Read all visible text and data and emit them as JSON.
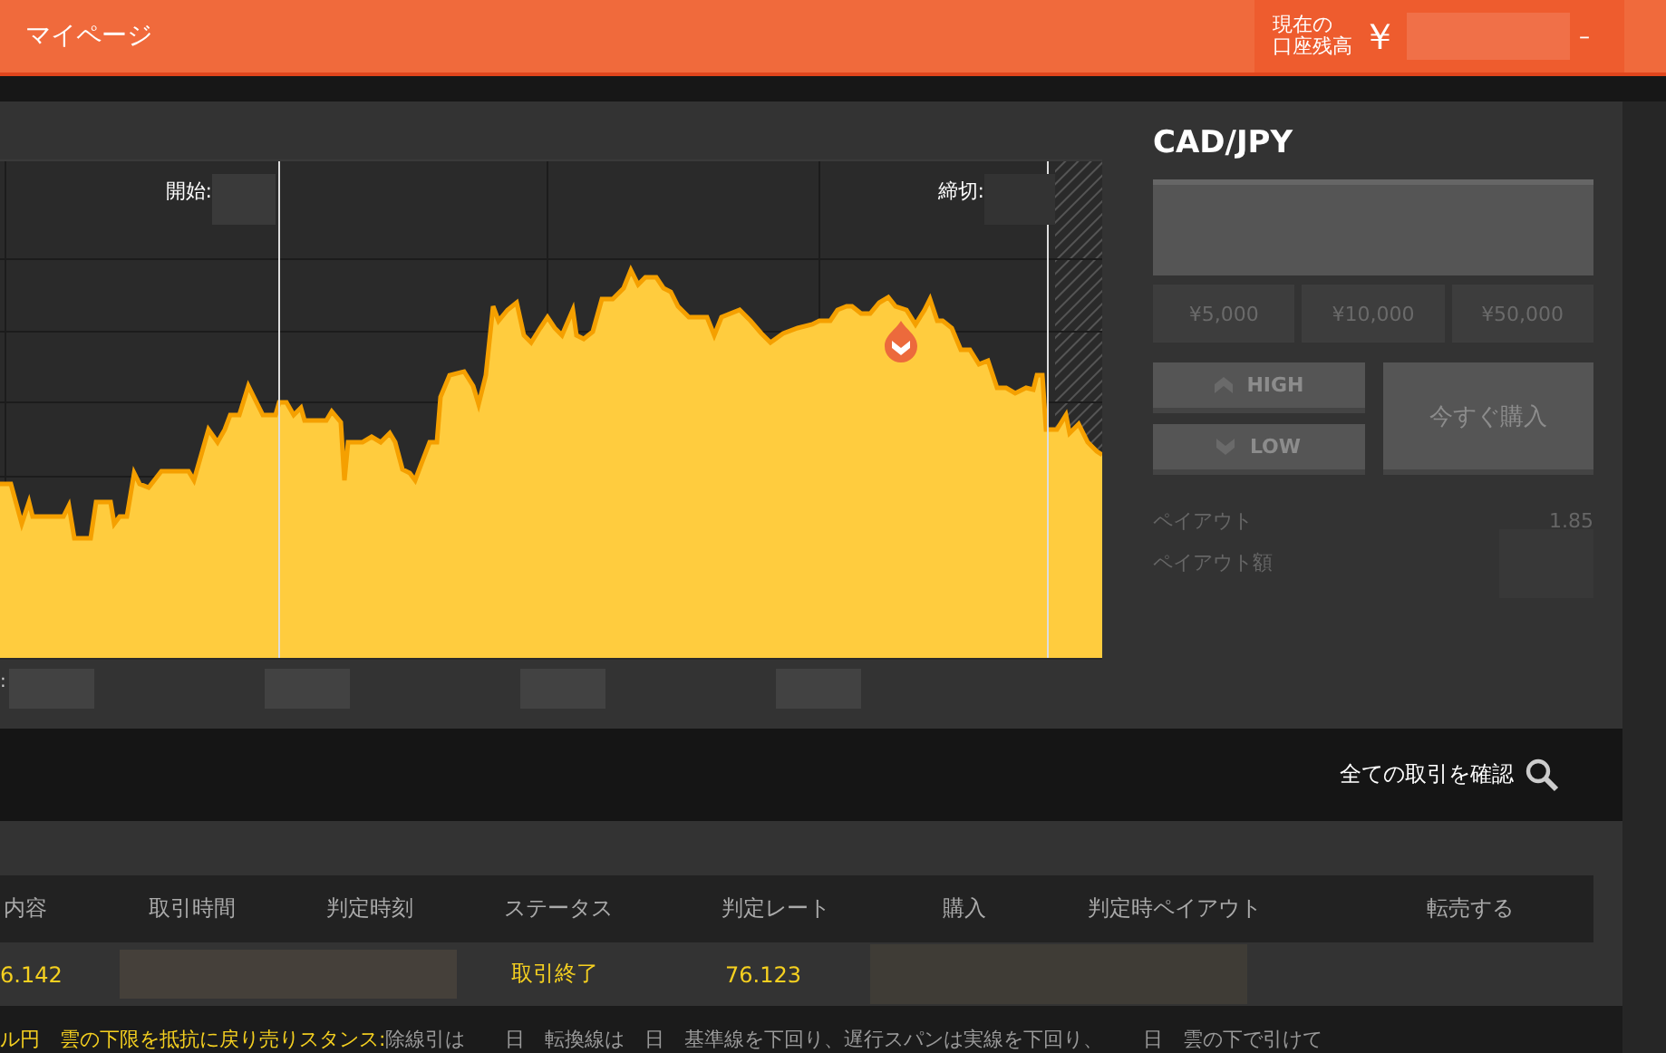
{
  "header": {
    "title": "マイページ",
    "balance_label_lines": [
      "現在の",
      "口座残高"
    ],
    "currency": "￥",
    "dash": "–"
  },
  "chart": {
    "start_label": "開始:",
    "end_label": "締切:",
    "axis_label": ":"
  },
  "trade_panel": {
    "pair": "CAD/JPY",
    "amounts": [
      "¥5,000",
      "¥10,000",
      "¥50,000"
    ],
    "high": "HIGH",
    "low": "LOW",
    "buy": "今すぐ購入",
    "payout_label": "ペイアウト",
    "payout_value": "1.85",
    "payout_amount_label": "ペイアウト額"
  },
  "all_trades_link": "全ての取引を確認",
  "table": {
    "columns": [
      "内容",
      "取引時間",
      "判定時刻",
      "ステータス",
      "判定レート",
      "購入",
      "判定時ペイアウト",
      "転売する"
    ],
    "rows": [
      {
        "content": "6.142",
        "status": "取引終了",
        "rate": "76.123"
      }
    ]
  },
  "ticker": {
    "highlight": "ル円　雲の下限を抵抗に戻り売りスタンス:",
    "text": "除線引は　　日　転換線は　日　基準線を下回り、遅行スパンは実線を下回り、　　日　雲の下で引けて"
  }
}
